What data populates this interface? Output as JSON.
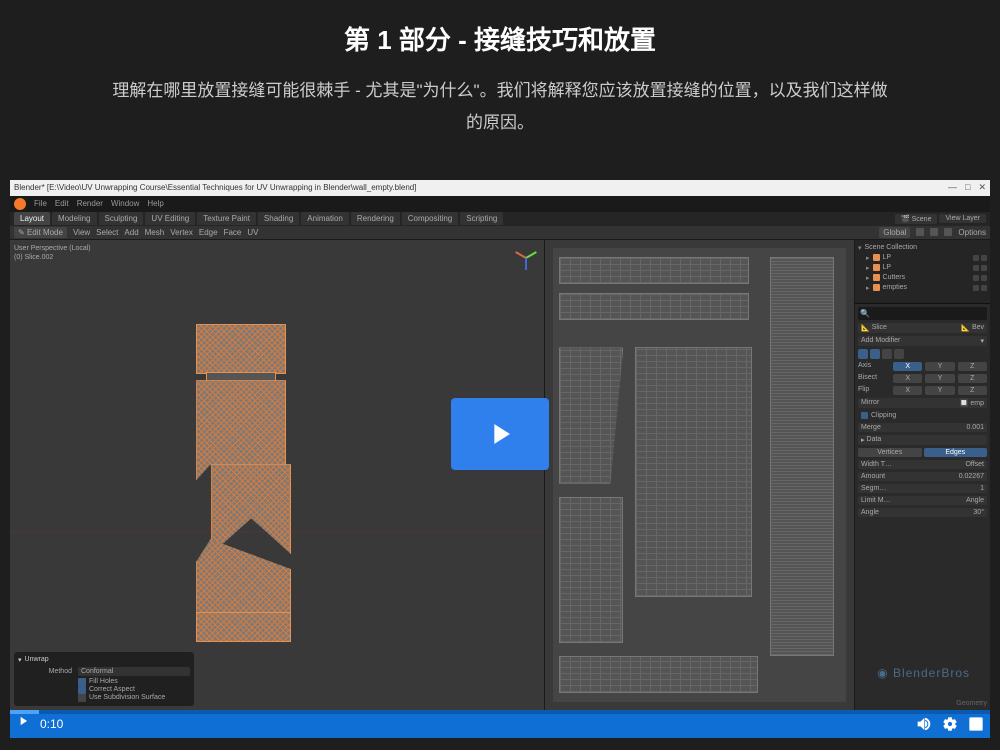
{
  "header": {
    "title": "第 1 部分 - 接缝技巧和放置",
    "description": "理解在哪里放置接缝可能很棘手 - 尤其是\"为什么\"。我们将解释您应该放置接缝的位置，以及我们这样做的原因。"
  },
  "windows": {
    "title": "Blender* [E:\\Video\\UV Unwrapping Course\\Essential Techniques for UV Unwrapping in Blender\\wall_empty.blend]",
    "minimize": "—",
    "maximize": "□",
    "close": "✕"
  },
  "menubar": {
    "items": [
      "File",
      "Edit",
      "Render",
      "Window",
      "Help"
    ]
  },
  "workspaces": {
    "tabs": [
      "Layout",
      "Modeling",
      "Sculpting",
      "UV Editing",
      "Texture Paint",
      "Shading",
      "Animation",
      "Rendering",
      "Compositing",
      "Scripting"
    ],
    "active_index": 0,
    "scene_label": "Scene",
    "viewlayer_label": "View Layer"
  },
  "toolbar": {
    "mode": "Edit Mode",
    "items": [
      "View",
      "Select",
      "Add",
      "Mesh",
      "Vertex",
      "Edge",
      "Face",
      "UV"
    ],
    "global": "Global",
    "options": "Options"
  },
  "viewport": {
    "perspective": "User Perspective (Local)",
    "object_name": "(0) Slice.002"
  },
  "outliner": {
    "root": "Scene Collection",
    "items": [
      "LP",
      "LP",
      "Cutters",
      "empties"
    ]
  },
  "properties": {
    "slice": "Slice",
    "bev": "Bev",
    "add_modifier": "Add Modifier",
    "axis": "Axis",
    "bisect": "Bisect",
    "flip": "Flip",
    "xyz": [
      "X",
      "Y",
      "Z"
    ],
    "mirror": "Mirror",
    "emp": "emp",
    "clipping": "Clipping",
    "merge": "Merge",
    "merge_val": "0.001",
    "data": "Data",
    "vertices": "Vertices",
    "edges": "Edges",
    "width_type": "Width T…",
    "offset": "Offset",
    "amount": "Amount",
    "amount_val": "0.02267",
    "segments": "Segm…",
    "segments_val": "1",
    "limit": "Limit M…",
    "angle": "Angle",
    "angle_val": "30°"
  },
  "unwrap": {
    "title": "Unwrap",
    "method_label": "Method",
    "method_value": "Conformal",
    "fill_holes": "Fill Holes",
    "correct_aspect": "Correct Aspect",
    "use_subdiv": "Use Subdivision Surface"
  },
  "watermark": "BlenderBros",
  "geometry": "Geometry",
  "video": {
    "current_time": "0:10"
  }
}
